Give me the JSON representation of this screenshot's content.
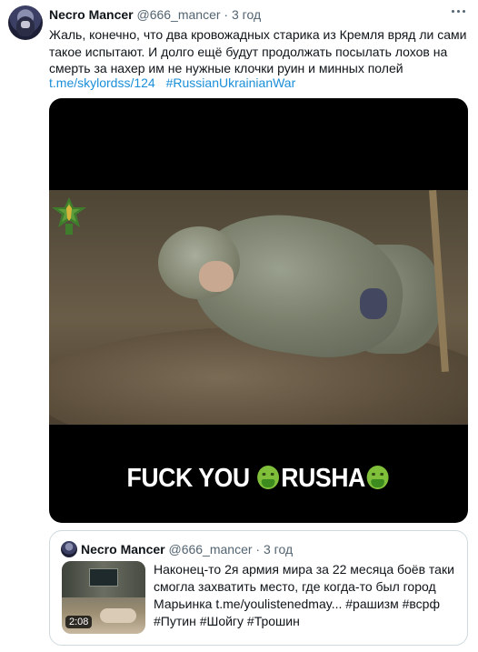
{
  "tweet": {
    "author_name": "Necro Mancer",
    "handle": "@666_mancer",
    "separator": "·",
    "time": "3 год",
    "text": "Жаль, конечно, что два кровожадных старика из Кремля вряд ли сами такое испытают. И долго ещё будут продолжать посылать лохов на смерть за нахер им не нужные клочки руин и минных полей",
    "link": "t.me/skylordss/124",
    "hashtag": "#RussianUkrainianWar",
    "more_icon": "more-horizontal-icon"
  },
  "media": {
    "caption_part1": "FUCK YOU",
    "caption_part2": "RUSHA",
    "emoji_icon": "nauseated-face-icon"
  },
  "quote": {
    "author_name": "Necro Mancer",
    "handle": "@666_mancer",
    "separator": "·",
    "time": "3 год",
    "text": "Наконец-то 2я армия мира за 22 месяца боёв таки смогла захватить место, где когда-то был город Марьинка t.me/youlistenedmay... #рашизм #всрф #Путин #Шойгу #Трошин",
    "duration": "2:08"
  }
}
